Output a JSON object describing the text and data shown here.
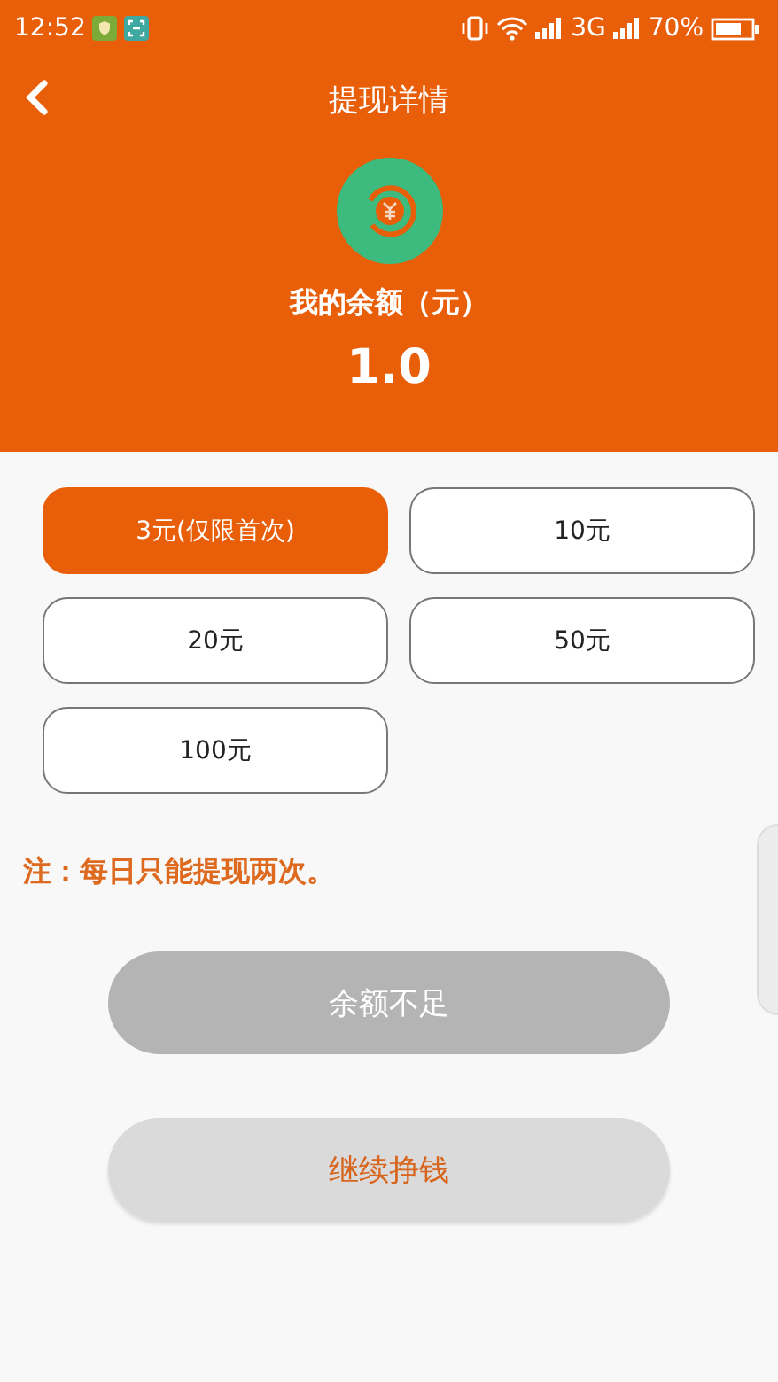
{
  "status_bar": {
    "time": "12:52",
    "network": "3G",
    "battery": "70%"
  },
  "header": {
    "title": "提现详情",
    "balance_label": "我的余额（元）",
    "balance": "1.0"
  },
  "options": [
    {
      "label": "3元(仅限首次)",
      "selected": true
    },
    {
      "label": "10元",
      "selected": false
    },
    {
      "label": "20元",
      "selected": false
    },
    {
      "label": "50元",
      "selected": false
    },
    {
      "label": "100元",
      "selected": false
    }
  ],
  "note": "注：每日只能提现两次。",
  "buttons": [
    {
      "label": "余额不足",
      "disabled": true
    },
    {
      "label": "继续挣钱",
      "disabled": false
    }
  ]
}
